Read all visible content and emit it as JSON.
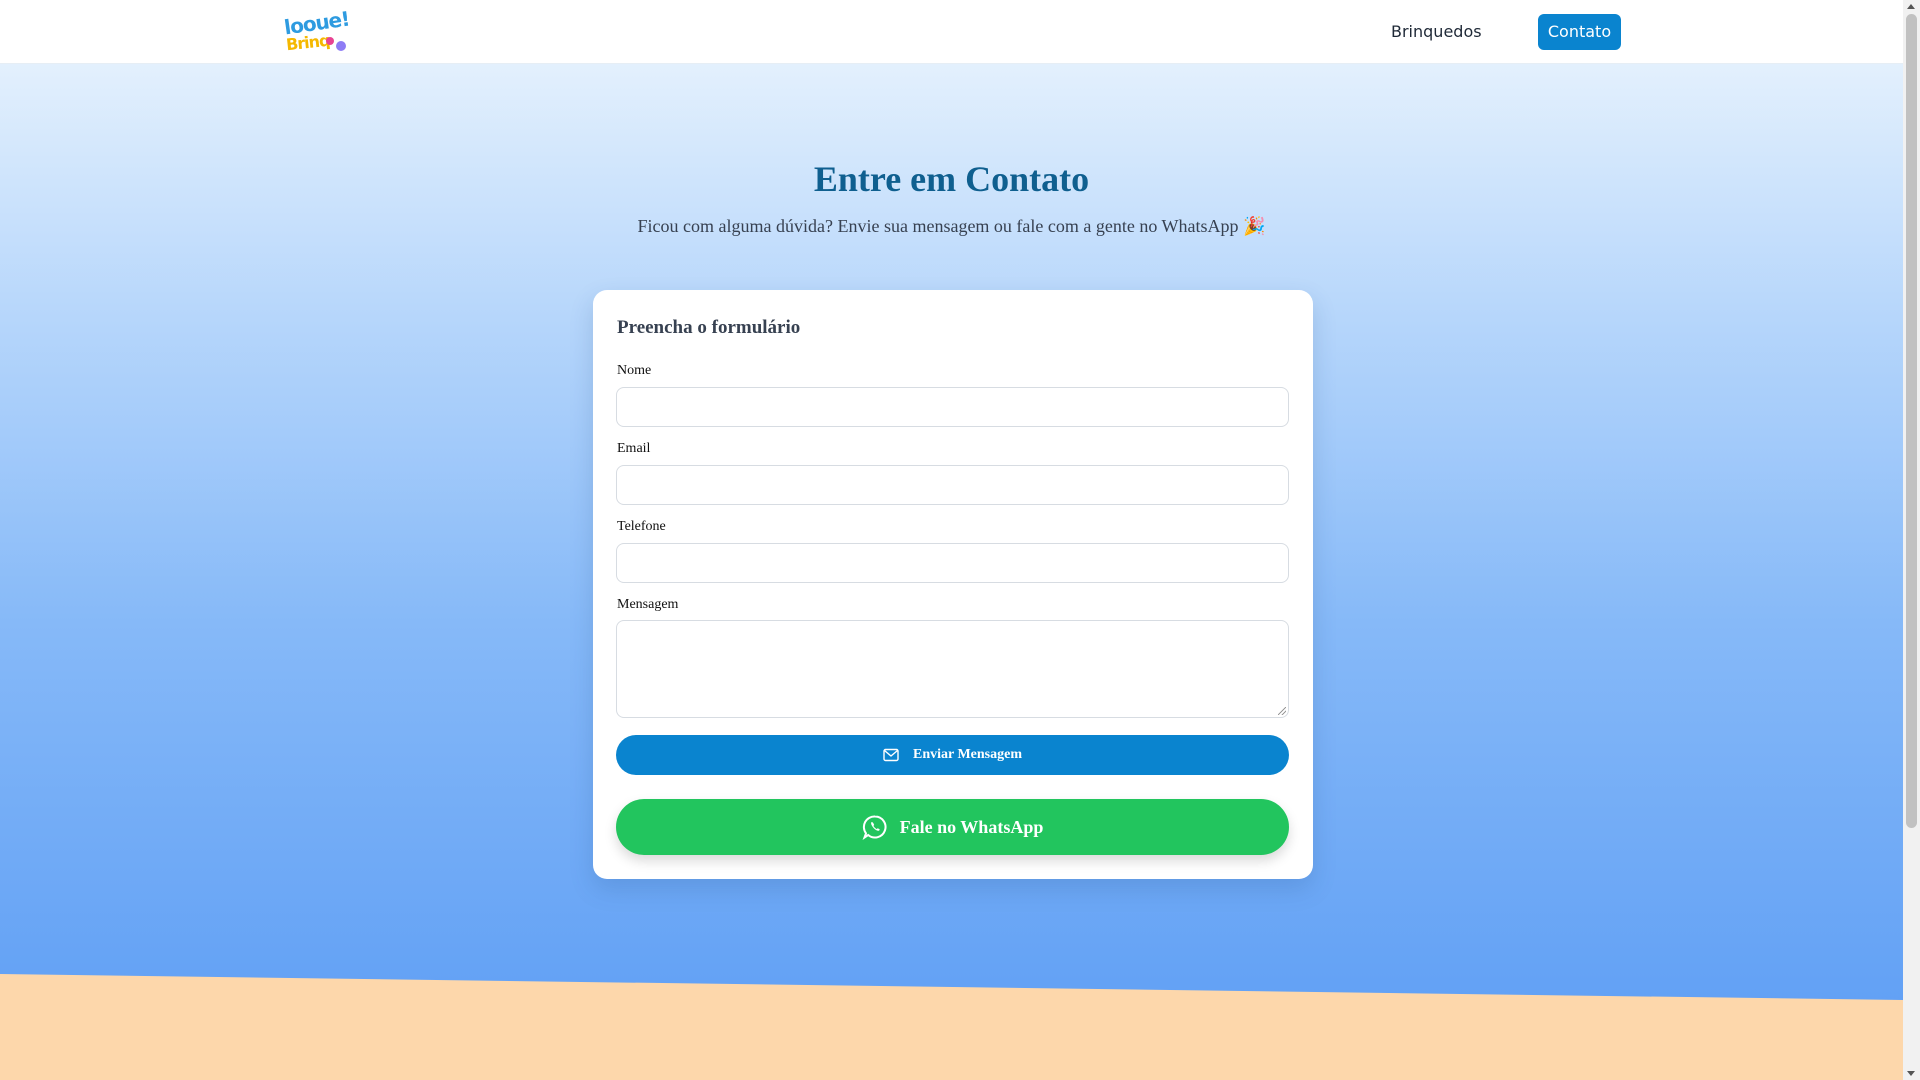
{
  "header": {
    "logo": {
      "line1": "looue!",
      "line2": "Brinq"
    },
    "nav": {
      "toys_label": "Brinquedos",
      "contact_label": "Contato"
    }
  },
  "hero": {
    "title": "Entre em Contato",
    "subtitle": "Ficou com alguma dúvida? Envie sua mensagem ou fale com a gente no WhatsApp 🎉"
  },
  "form": {
    "title": "Preencha o formulário",
    "fields": {
      "name": {
        "label": "Nome",
        "value": ""
      },
      "email": {
        "label": "Email",
        "value": ""
      },
      "phone": {
        "label": "Telefone",
        "value": ""
      },
      "message": {
        "label": "Mensagem",
        "value": ""
      }
    },
    "submit_label": "Enviar Mensagem",
    "whatsapp_label": "Fale no WhatsApp"
  },
  "colors": {
    "primary": "#0a84cf",
    "whatsapp": "#22c55e",
    "title": "#0f5f8f",
    "sand": "#fdd7ab"
  },
  "icons": [
    "mail-icon",
    "whatsapp-icon"
  ]
}
